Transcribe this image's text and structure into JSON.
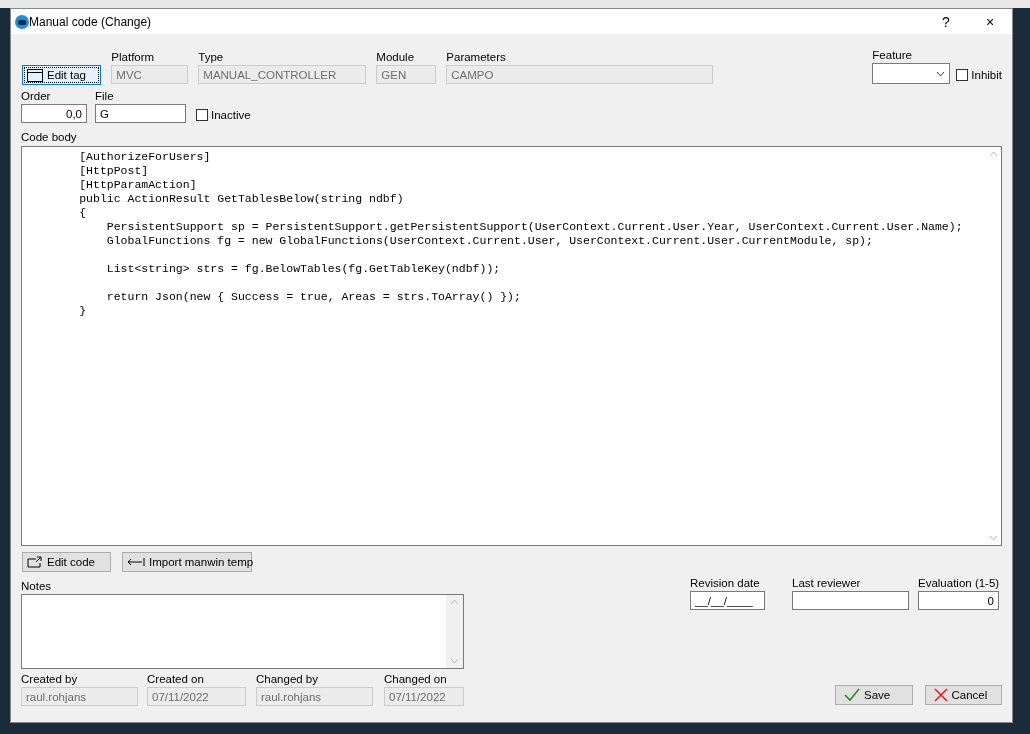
{
  "window": {
    "title": "Manual code (Change)",
    "controls": [
      "?",
      "×"
    ]
  },
  "edit_tag_button": {
    "label": "Edit tag"
  },
  "header_fields": [
    {
      "label": "Platform",
      "value": "MVC",
      "disabled": true
    },
    {
      "label": "Type",
      "value": "MANUAL_CONTROLLER",
      "disabled": true
    },
    {
      "label": "Module",
      "value": "GEN",
      "disabled": true
    },
    {
      "label": "Parameters",
      "value": "CAMPO",
      "disabled": true
    }
  ],
  "feature": {
    "label": "Feature"
  },
  "inhibit": {
    "label": "Inhibit",
    "checked": false
  },
  "order": {
    "label": "Order",
    "value": "0,0"
  },
  "file": {
    "label": "File",
    "value": "G"
  },
  "inactive": {
    "label": "Inactive",
    "checked": false
  },
  "code_body": {
    "label": "Code body",
    "code": "        [AuthorizeForUsers]\n        [HttpPost]\n        [HttpParamAction]\n        public ActionResult GetTablesBelow(string ndbf)\n        {\n            PersistentSupport sp = PersistentSupport.getPersistentSupport(UserContext.Current.User.Year, UserContext.Current.User.Name);\n            GlobalFunctions fg = new GlobalFunctions(UserContext.Current.User, UserContext.Current.User.CurrentModule, sp);\n\n            List<string> strs = fg.BelowTables(fg.GetTableKey(ndbf));\n\n            return Json(new { Success = true, Areas = strs.ToArray() });\n        }"
  },
  "code_buttons": [
    {
      "label": "Edit code",
      "kind": "edit"
    },
    {
      "label": "Import manwin temp",
      "kind": "import"
    }
  ],
  "notes": {
    "label": "Notes"
  },
  "review_fields": [
    {
      "label": "Revision date",
      "value": "__/__/____"
    },
    {
      "label": "Last reviewer"
    },
    {
      "label": "Evaluation (1-5)",
      "value": "0"
    }
  ],
  "audit_fields": [
    {
      "label": "Created by",
      "value": "raul.rohjans",
      "disabled": true
    },
    {
      "label": "Created on",
      "value": "07/11/2022",
      "disabled": true
    },
    {
      "label": "Changed by",
      "value": "raul.rohjans",
      "disabled": true
    },
    {
      "label": "Changed on",
      "value": "07/11/2022",
      "disabled": true
    }
  ],
  "dialog_buttons": [
    {
      "label": "Save",
      "kind": "save"
    },
    {
      "label": "Cancel",
      "kind": "cancel"
    }
  ]
}
